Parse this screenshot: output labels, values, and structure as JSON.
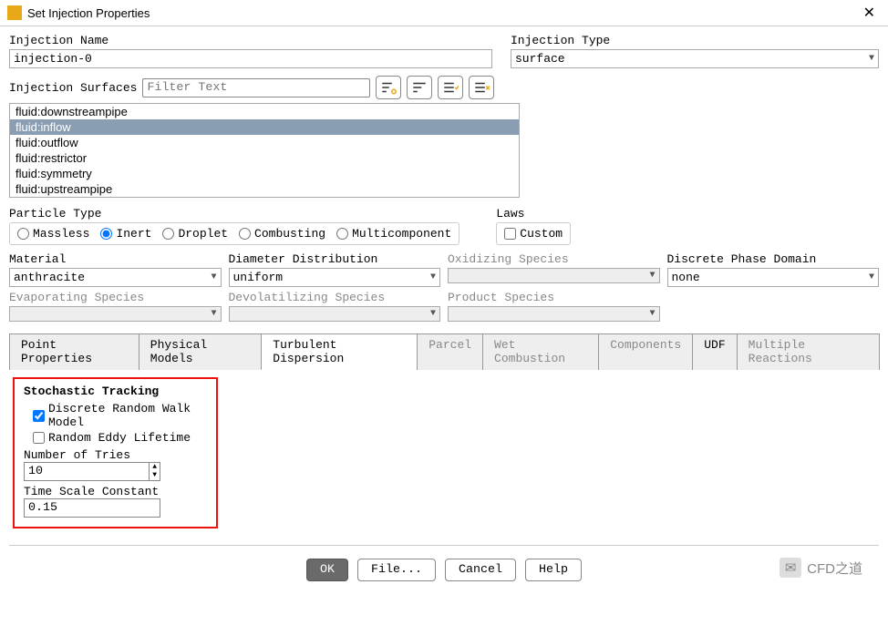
{
  "window": {
    "title": "Set Injection Properties"
  },
  "injectionName": {
    "label": "Injection Name",
    "value": "injection-0"
  },
  "injectionType": {
    "label": "Injection Type",
    "value": "surface"
  },
  "surfaces": {
    "label": "Injection Surfaces",
    "filterPlaceholder": "Filter Text",
    "items": [
      "fluid:downstreampipe",
      "fluid:inflow",
      "fluid:outflow",
      "fluid:restrictor",
      "fluid:symmetry",
      "fluid:upstreampipe"
    ],
    "selectedIndex": 1
  },
  "particleType": {
    "label": "Particle Type",
    "options": [
      "Massless",
      "Inert",
      "Droplet",
      "Combusting",
      "Multicomponent"
    ],
    "selected": "Inert"
  },
  "laws": {
    "label": "Laws",
    "custom": "Custom",
    "checked": false
  },
  "row1": {
    "material": {
      "label": "Material",
      "value": "anthracite"
    },
    "diameter": {
      "label": "Diameter Distribution",
      "value": "uniform"
    },
    "oxidizing": {
      "label": "Oxidizing Species",
      "value": ""
    },
    "domain": {
      "label": "Discrete Phase Domain",
      "value": "none"
    }
  },
  "row2": {
    "evap": {
      "label": "Evaporating Species",
      "value": ""
    },
    "devol": {
      "label": "Devolatilizing Species",
      "value": ""
    },
    "product": {
      "label": "Product Species",
      "value": ""
    }
  },
  "tabs": [
    "Point Properties",
    "Physical Models",
    "Turbulent Dispersion",
    "Parcel",
    "Wet Combustion",
    "Components",
    "UDF",
    "Multiple Reactions"
  ],
  "activeTab": 2,
  "disabledTabs": [
    3,
    4,
    5,
    7
  ],
  "stochastic": {
    "header": "Stochastic Tracking",
    "drw": {
      "label": "Discrete Random Walk Model",
      "checked": true
    },
    "rel": {
      "label": "Random Eddy Lifetime",
      "checked": false
    },
    "tries": {
      "label": "Number of Tries",
      "value": "10"
    },
    "tsc": {
      "label": "Time Scale Constant",
      "value": "0.15"
    }
  },
  "buttons": {
    "ok": "OK",
    "file": "File...",
    "cancel": "Cancel",
    "help": "Help"
  },
  "watermark": "CFD之道"
}
